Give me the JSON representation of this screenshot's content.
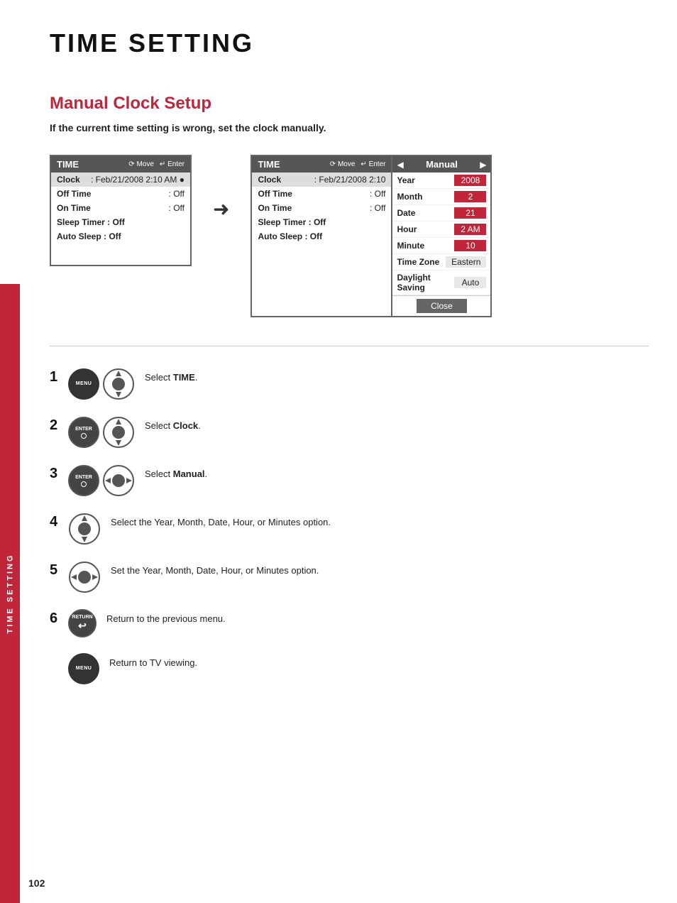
{
  "page": {
    "title": "TIME SETTING",
    "page_number": "102"
  },
  "side_bar": {
    "label": "TIME SETTING"
  },
  "section": {
    "title": "Manual Clock Setup",
    "description": "If the current time setting is wrong, set the clock manually."
  },
  "panel_left": {
    "header_title": "TIME",
    "nav_move": "Move",
    "nav_enter": "Enter",
    "rows": [
      {
        "label": "Clock",
        "value": ": Feb/21/2008 2:10 AM",
        "highlighted": true
      },
      {
        "label": "Off Time",
        "value": ": Off",
        "highlighted": false
      },
      {
        "label": "On Time",
        "value": ": Off",
        "highlighted": false
      },
      {
        "label": "Sleep Timer",
        "value": ": Off",
        "highlighted": false
      },
      {
        "label": "Auto Sleep",
        "value": ": Off",
        "highlighted": false
      }
    ]
  },
  "panel_right": {
    "header_title": "TIME",
    "nav_move": "Move",
    "nav_enter": "Enter",
    "rows": [
      {
        "label": "Clock",
        "value": ": Feb/21/2008 2:10",
        "highlighted": true
      },
      {
        "label": "Off Time",
        "value": ": Off",
        "highlighted": false
      },
      {
        "label": "On Time",
        "value": ": Off",
        "highlighted": false
      },
      {
        "label": "Sleep Timer",
        "value": ": Off",
        "highlighted": false
      },
      {
        "label": "Auto Sleep",
        "value": ": Off",
        "highlighted": false
      }
    ],
    "manual_label": "Manual",
    "settings": [
      {
        "label": "Year",
        "value": "2008",
        "style": "red"
      },
      {
        "label": "Month",
        "value": "2",
        "style": "red"
      },
      {
        "label": "Date",
        "value": "21",
        "style": "red"
      },
      {
        "label": "Hour",
        "value": "2 AM",
        "style": "red"
      },
      {
        "label": "Minute",
        "value": "10",
        "style": "red"
      },
      {
        "label": "Time Zone",
        "value": "Eastern",
        "style": "light"
      },
      {
        "label": "Daylight Saving",
        "value": "Auto",
        "style": "light"
      }
    ],
    "close_button": "Close"
  },
  "steps": [
    {
      "number": "1",
      "icons": [
        "menu",
        "nav-ud"
      ],
      "text": "Select ",
      "bold": "TIME",
      "text_suffix": "."
    },
    {
      "number": "2",
      "icons": [
        "enter",
        "nav-ud"
      ],
      "text": "Select ",
      "bold": "Clock",
      "text_suffix": "."
    },
    {
      "number": "3",
      "icons": [
        "enter",
        "nav-lr"
      ],
      "text": "Select ",
      "bold": "Manual",
      "text_suffix": "."
    },
    {
      "number": "4",
      "icons": [
        "nav-ud"
      ],
      "text": "Select the Year, Month, Date, Hour, or Minutes option."
    },
    {
      "number": "5",
      "icons": [
        "nav-lr"
      ],
      "text": "Set the Year, Month, Date, Hour, or Minutes option."
    },
    {
      "number": "6",
      "icons": [
        "return"
      ],
      "text": "Return to the previous menu."
    },
    {
      "number": "",
      "icons": [
        "menu"
      ],
      "text": "Return to TV viewing."
    }
  ],
  "labels": {
    "menu": "MENU",
    "enter": "ENTER",
    "return": "RETURN"
  }
}
